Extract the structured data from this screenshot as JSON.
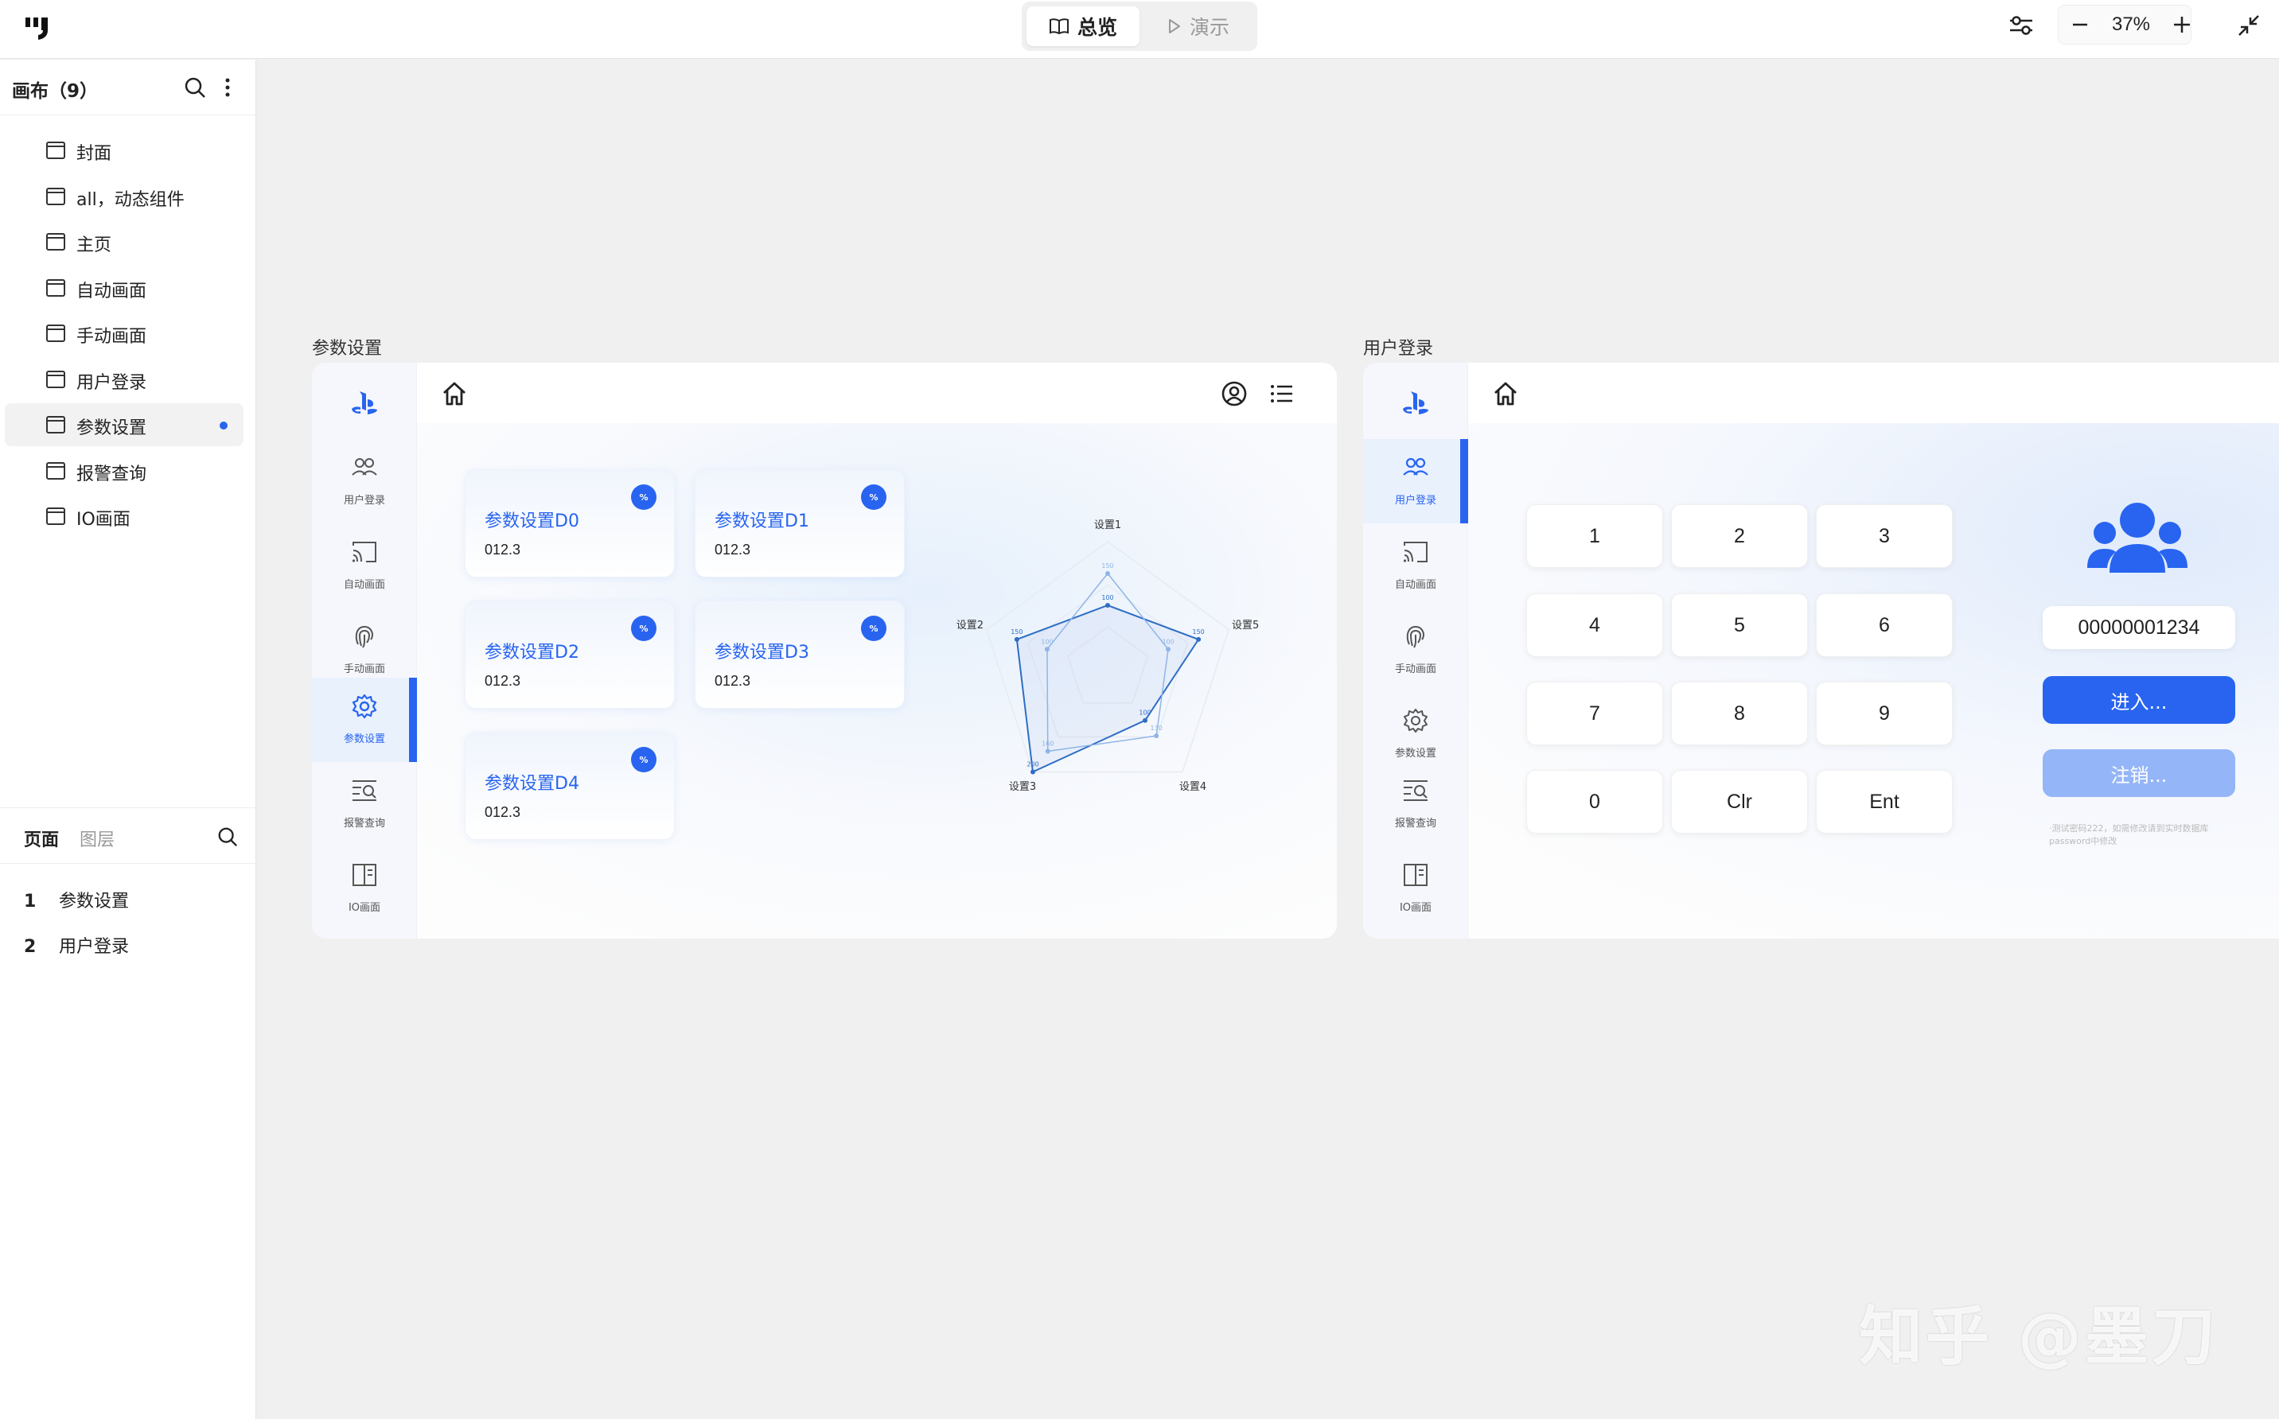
{
  "toolbar": {
    "logo": "logo-icon",
    "tab_overview": "总览",
    "tab_present": "演示",
    "zoom": "37%"
  },
  "canvas_panel": {
    "title": "画布（9）",
    "pages": [
      {
        "label": "封面"
      },
      {
        "label": "all，动态组件"
      },
      {
        "label": "主页"
      },
      {
        "label": "自动画面"
      },
      {
        "label": "手动画面"
      },
      {
        "label": "用户登录"
      },
      {
        "label": "参数设置",
        "active": true
      },
      {
        "label": "报警查询"
      },
      {
        "label": "IO画面"
      }
    ]
  },
  "bottom_panel": {
    "tab_pages": "页面",
    "tab_layers": "图层",
    "items": [
      {
        "num": "1",
        "label": "参数设置"
      },
      {
        "num": "2",
        "label": "用户登录"
      }
    ]
  },
  "frame_params": {
    "label": "参数设置",
    "nav": [
      {
        "label": "用户登录"
      },
      {
        "label": "自动画面"
      },
      {
        "label": "手动画面"
      },
      {
        "label": "参数设置"
      },
      {
        "label": "报警查询"
      },
      {
        "label": "IO画面"
      }
    ],
    "cards": [
      {
        "title": "参数设置D0",
        "value": "012.3"
      },
      {
        "title": "参数设置D1",
        "value": "012.3"
      },
      {
        "title": "参数设置D2",
        "value": "012.3"
      },
      {
        "title": "参数设置D3",
        "value": "012.3"
      },
      {
        "title": "参数设置D4",
        "value": "012.3"
      }
    ],
    "badge": "%"
  },
  "chart_data": {
    "type": "radar",
    "axes": [
      "设置1",
      "设置5",
      "设置4",
      "设置3",
      "设置2"
    ],
    "max": 200,
    "series": [
      {
        "values": [
          100,
          150,
          100,
          200,
          150
        ]
      },
      {
        "values": [
          150,
          100,
          130,
          160,
          100
        ]
      }
    ],
    "colors": [
      "#2e6ec4",
      "#8fb5e6"
    ]
  },
  "frame_login": {
    "label": "用户登录",
    "nav": [
      {
        "label": "用户登录"
      },
      {
        "label": "自动画面"
      },
      {
        "label": "手动画面"
      },
      {
        "label": "参数设置"
      },
      {
        "label": "报警查询"
      },
      {
        "label": "IO画面"
      }
    ],
    "keys": [
      "1",
      "2",
      "3",
      "4",
      "5",
      "6",
      "7",
      "8",
      "9",
      "0",
      "Clr",
      "Ent"
    ],
    "user_id": "00000001234",
    "enter_label": "进入...",
    "logout_label": "注销...",
    "hint": "·测试密码222，如需修改请到实时数据库password中修改"
  },
  "watermark": "知乎 @墨刀",
  "colors": {
    "accent": "#2864f0",
    "accent_light": "#94b5f7",
    "canvas_bg": "#f0f0f0"
  }
}
